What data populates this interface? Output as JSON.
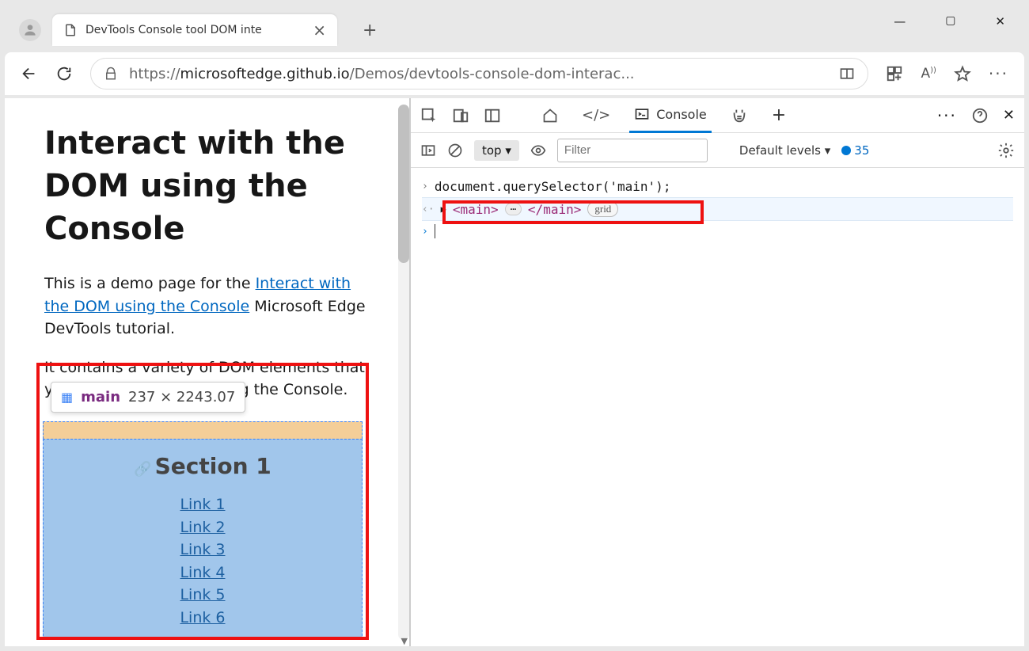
{
  "tab": {
    "title": "DevTools Console tool DOM inte"
  },
  "url": {
    "prefix": "https://",
    "host": "microsoftedge.github.io",
    "path": "/Demos/devtools-console-dom-interac..."
  },
  "page": {
    "heading": "Interact with the DOM using the Console",
    "intro_prefix": "This is a demo page for the ",
    "intro_link": "Interact with the DOM using the Console",
    "intro_suffix": " Microsoft Edge DevTools tutorial.",
    "para2": "It contains a variety of DOM elements that you can interact with using the Console.",
    "tooltip_name": "main",
    "tooltip_dim": "237 × 2243.07",
    "section_title": "Section 1",
    "links": [
      "Link 1",
      "Link 2",
      "Link 3",
      "Link 4",
      "Link 5",
      "Link 6"
    ]
  },
  "devtools": {
    "console_label": "Console",
    "context": "top",
    "filter_placeholder": "Filter",
    "levels": "Default levels",
    "issues_count": "35",
    "input": "document.querySelector('main');",
    "result_open": "<main>",
    "result_close": "</main>",
    "grid_badge": "grid"
  }
}
